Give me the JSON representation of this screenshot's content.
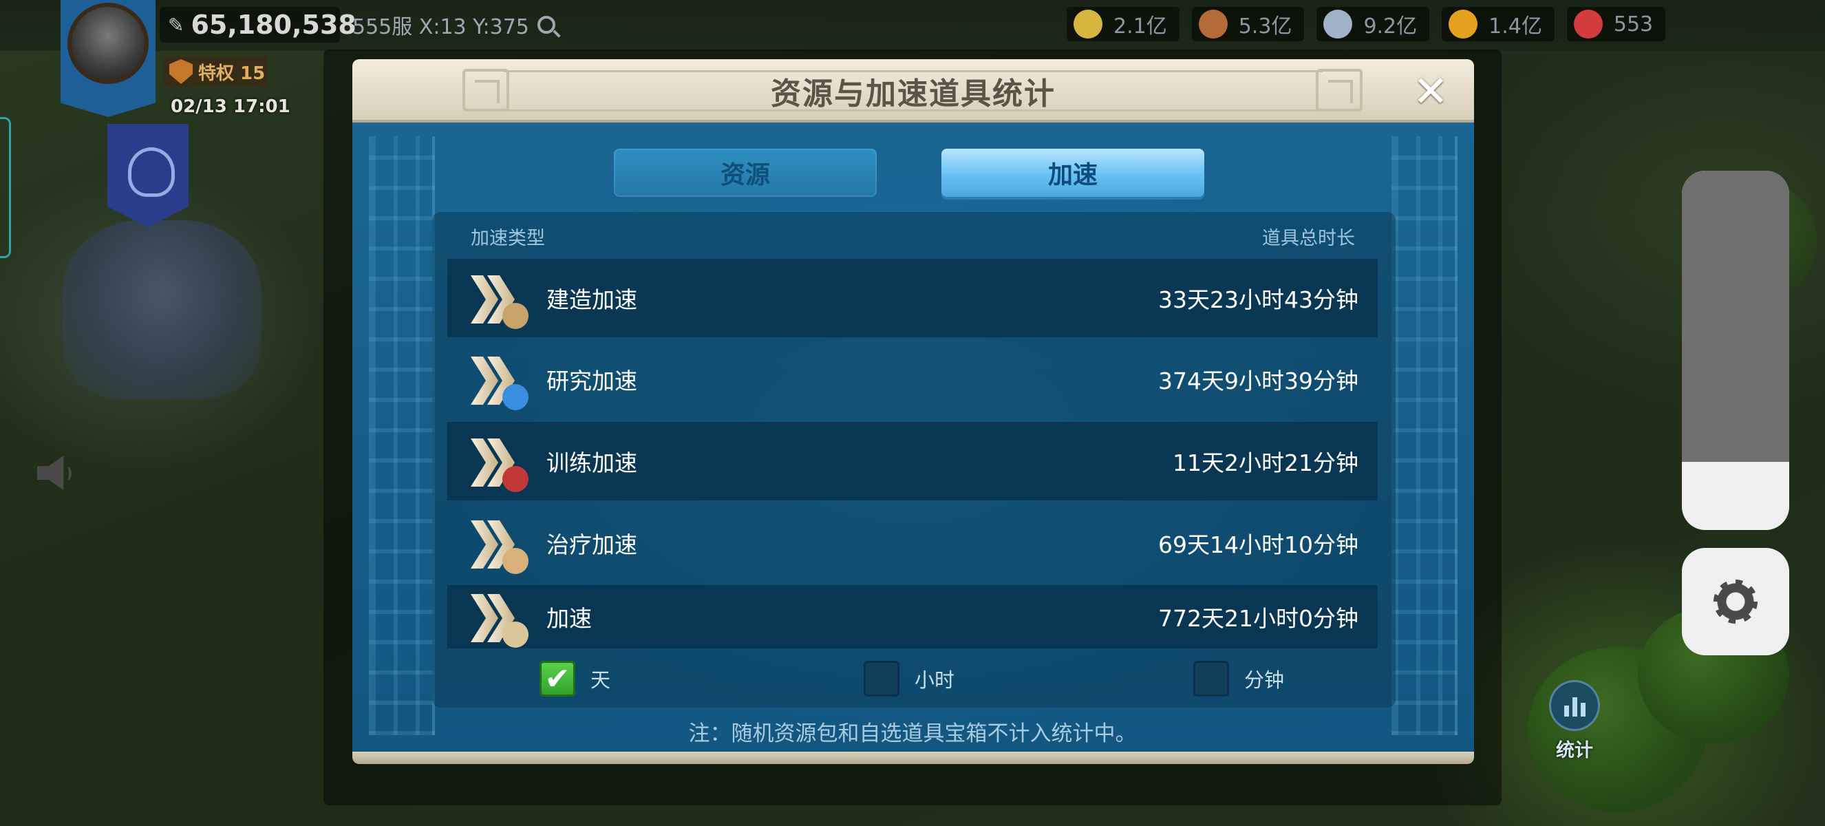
{
  "hud": {
    "power": "65,180,538",
    "coordinates": "555服 X:13 Y:375",
    "resources": [
      {
        "icon": "grain-icon",
        "color": "#d7b640",
        "value": "2.1亿"
      },
      {
        "icon": "wood-icon",
        "color": "#b56a3a",
        "value": "5.3亿"
      },
      {
        "icon": "stone-icon",
        "color": "#9fb2c8",
        "value": "9.2亿"
      },
      {
        "icon": "gold-icon",
        "color": "#e5a21f",
        "value": "1.4亿"
      },
      {
        "icon": "gem-icon",
        "color": "#d23c3c",
        "value": "553"
      }
    ],
    "vip_label": "特权 15",
    "timestamp": "02/13 17:01"
  },
  "modal": {
    "title": "资源与加速道具统计",
    "close_glyph": "✕",
    "tabs": [
      {
        "label": "资源",
        "active": false
      },
      {
        "label": "加速",
        "active": true
      }
    ],
    "column_type": "加速类型",
    "column_total": "道具总时长",
    "rows": [
      {
        "label": "建造加速",
        "value": "33天23小时43分钟",
        "icon": "build-speedup-icon",
        "badge_color": "#c9a46a"
      },
      {
        "label": "研究加速",
        "value": "374天9小时39分钟",
        "icon": "research-speedup-icon",
        "badge_color": "#3a8ee0"
      },
      {
        "label": "训练加速",
        "value": "11天2小时21分钟",
        "icon": "training-speedup-icon",
        "badge_color": "#c23838"
      },
      {
        "label": "治疗加速",
        "value": "69天14小时10分钟",
        "icon": "healing-speedup-icon",
        "badge_color": "#d8b07a"
      },
      {
        "label": "加速",
        "value": "772天21小时0分钟",
        "icon": "universal-speedup-icon",
        "badge_color": "#d9c79a"
      }
    ],
    "filters": [
      {
        "label": "天",
        "checked": true
      },
      {
        "label": "小时",
        "checked": false
      },
      {
        "label": "分钟",
        "checked": false
      }
    ],
    "note": "注：随机资源包和自选道具宝箱不计入统计中。"
  },
  "side": {
    "stats_label": "统计",
    "volume_level": 0.81
  }
}
